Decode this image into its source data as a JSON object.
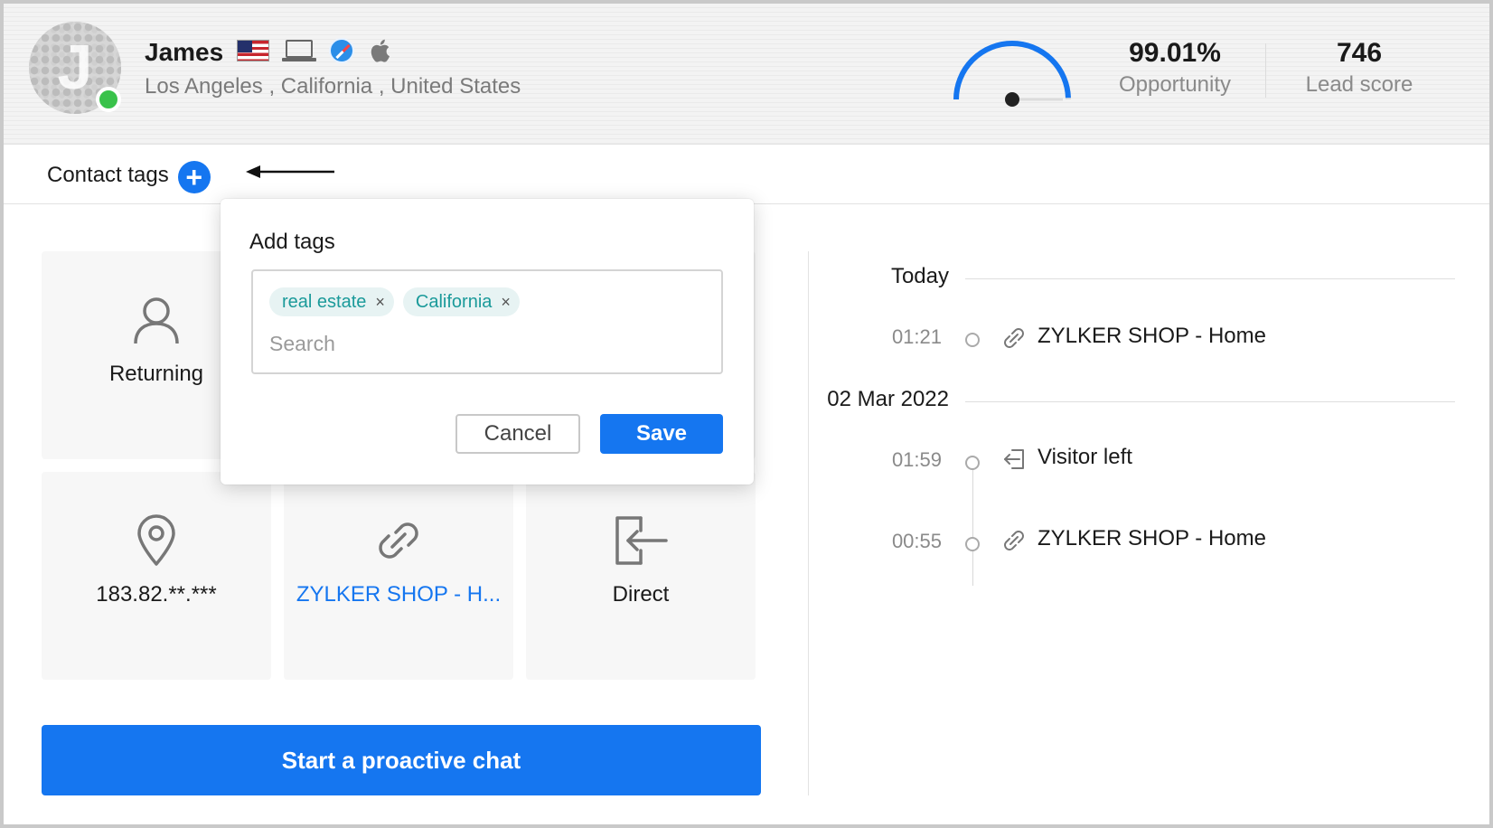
{
  "visitor": {
    "initial": "J",
    "name": "James",
    "location": "Los Angeles , California , United States",
    "icons": [
      "us-flag-icon",
      "laptop-icon",
      "safari-icon",
      "apple-icon"
    ]
  },
  "metrics": {
    "opportunity_value": "99.01%",
    "opportunity_label": "Opportunity",
    "lead_score_value": "746",
    "lead_score_label": "Lead score",
    "gauge_fraction": 0.99
  },
  "contact_tags": {
    "label": "Contact tags",
    "add_symbol": "+"
  },
  "cards": [
    {
      "icon": "user-icon",
      "text": "Returning"
    },
    {
      "icon": "",
      "text": ""
    },
    {
      "icon": "",
      "text": ""
    },
    {
      "icon": "location-pin-icon",
      "text": "183.82.**.***"
    },
    {
      "icon": "link-icon",
      "text": "ZYLKER SHOP - H..."
    },
    {
      "icon": "direct-entry-icon",
      "text": "Direct"
    }
  ],
  "cta_label": "Start a proactive chat",
  "timeline": {
    "groups": [
      {
        "day": "Today",
        "events": [
          {
            "time": "01:21",
            "icon": "link-icon",
            "text": "ZYLKER SHOP - Home"
          }
        ]
      },
      {
        "day": "02 Mar 2022",
        "events": [
          {
            "time": "01:59",
            "icon": "exit-icon",
            "text": "Visitor left"
          },
          {
            "time": "00:55",
            "icon": "link-icon",
            "text": "ZYLKER SHOP - Home"
          }
        ]
      }
    ]
  },
  "add_tags_popup": {
    "title": "Add tags",
    "chips": [
      "real estate",
      "California"
    ],
    "remove_symbol": "×",
    "search_placeholder": "Search",
    "search_value": "",
    "cancel_label": "Cancel",
    "save_label": "Save"
  },
  "colors": {
    "accent": "#1576f0",
    "online": "#39c24a",
    "chip_text": "#1a9a9a",
    "chip_bg": "#e7f3f3"
  }
}
